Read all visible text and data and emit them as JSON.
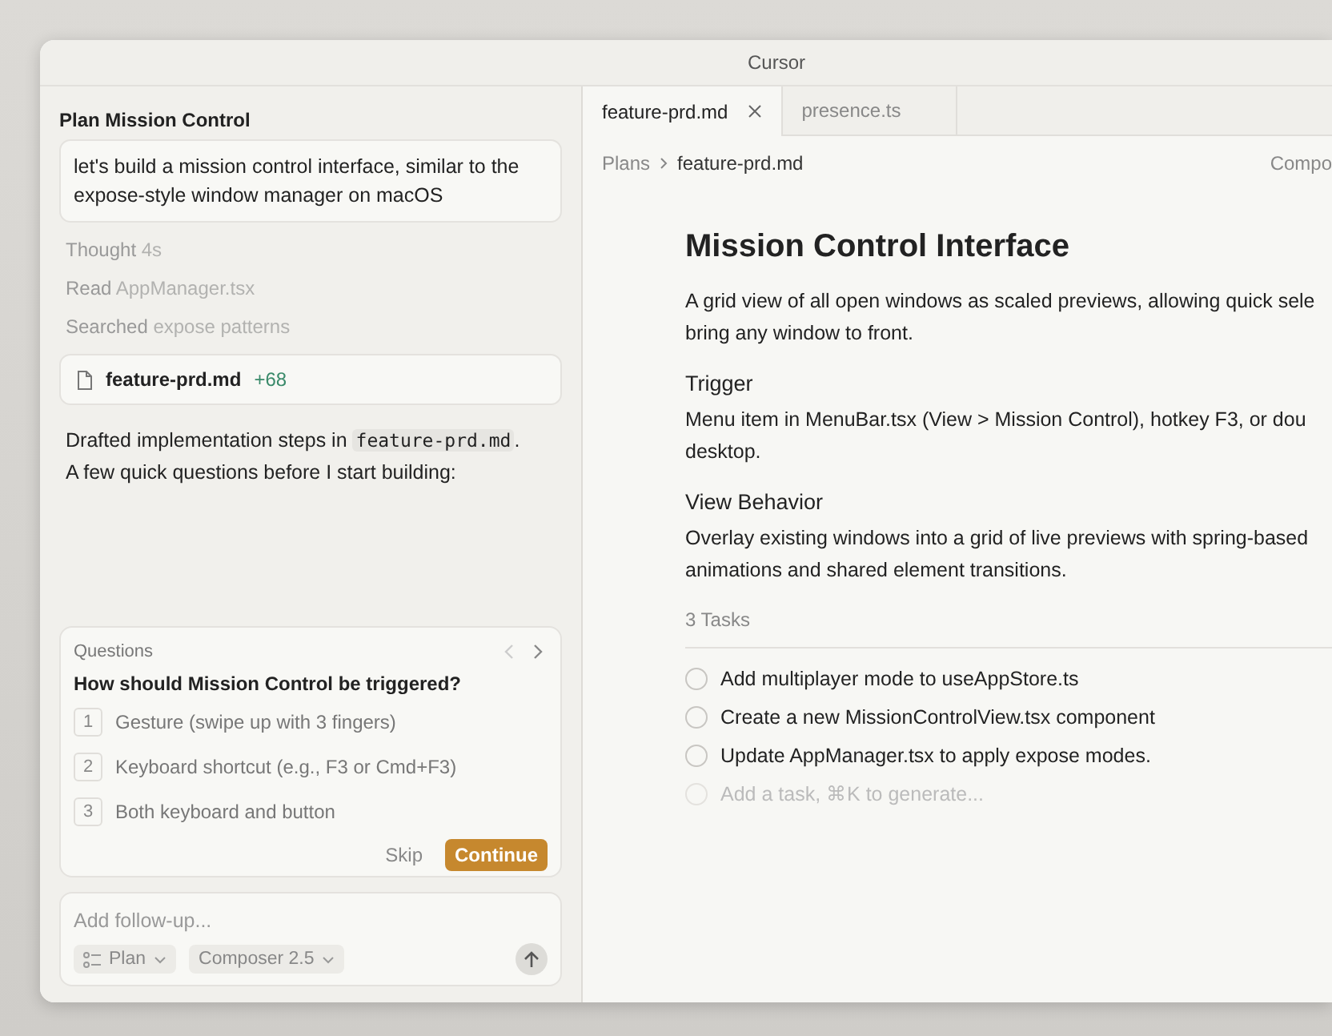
{
  "window": {
    "title": "Cursor"
  },
  "chat": {
    "title": "Plan Mission Control",
    "prompt": "let's build a mission control interface, similar to the expose-style window manager on macOS",
    "steps": [
      {
        "verb": "Thought",
        "detail": "4s"
      },
      {
        "verb": "Read",
        "detail": "AppManager.tsx"
      },
      {
        "verb": "Searched",
        "detail": "expose patterns"
      }
    ],
    "file_card": {
      "name": "feature-prd.md",
      "diff": "+68"
    },
    "message": [
      [
        {
          "kind": "text",
          "text": "Drafted implementation steps in "
        },
        {
          "kind": "code",
          "text": "feature-prd.md"
        },
        {
          "kind": "text",
          "text": "."
        }
      ],
      [
        {
          "kind": "text",
          "text": "A few quick questions before I start building:"
        }
      ]
    ],
    "questions": {
      "label": "Questions",
      "question": "How should Mission Control be triggered?",
      "options": [
        {
          "number": "1",
          "text": "Gesture (swipe up with 3 fingers)"
        },
        {
          "number": "2",
          "text": "Keyboard shortcut (e.g., F3 or Cmd+F3)"
        },
        {
          "number": "3",
          "text": "Both keyboard and button"
        }
      ],
      "buttons": [
        {
          "label": "Skip",
          "kind": "plain"
        },
        {
          "label": "Continue",
          "kind": "primary"
        }
      ]
    },
    "composer": {
      "placeholder": "Add follow-up...",
      "mode": "Plan",
      "model": "Composer 2.5"
    }
  },
  "editor": {
    "tabs": [
      {
        "label": "feature-prd.md",
        "selected": true
      },
      {
        "label": "presence.ts",
        "selected": false
      }
    ],
    "breadcrumb": [
      "Plans",
      "feature-prd.md"
    ],
    "toolbar_text": "Compo",
    "doc": {
      "title": "Mission Control Interface",
      "intro": [
        "A grid view of all open windows as scaled previews, allowing quick sele",
        "bring any window to front."
      ],
      "sections": [
        {
          "heading": "Trigger",
          "lines": [
            "Menu item in MenuBar.tsx (View > Mission Control), hotkey F3, or dou",
            "desktop."
          ]
        },
        {
          "heading": "View Behavior",
          "lines": [
            "Overlay existing windows into a grid of live previews with spring-based",
            "animations and shared element transitions."
          ]
        }
      ],
      "tasks_label": "3 Tasks",
      "tasks": [
        {
          "text": "Add multiplayer mode to useAppStore.ts",
          "checked": false
        },
        {
          "text": "Create a new MissionControlView.tsx component",
          "checked": false
        },
        {
          "text": "Update AppManager.tsx to apply expose modes.",
          "checked": false
        }
      ],
      "new_task": {
        "placeholder": "Add a task, ⌘K to generate..."
      }
    }
  }
}
